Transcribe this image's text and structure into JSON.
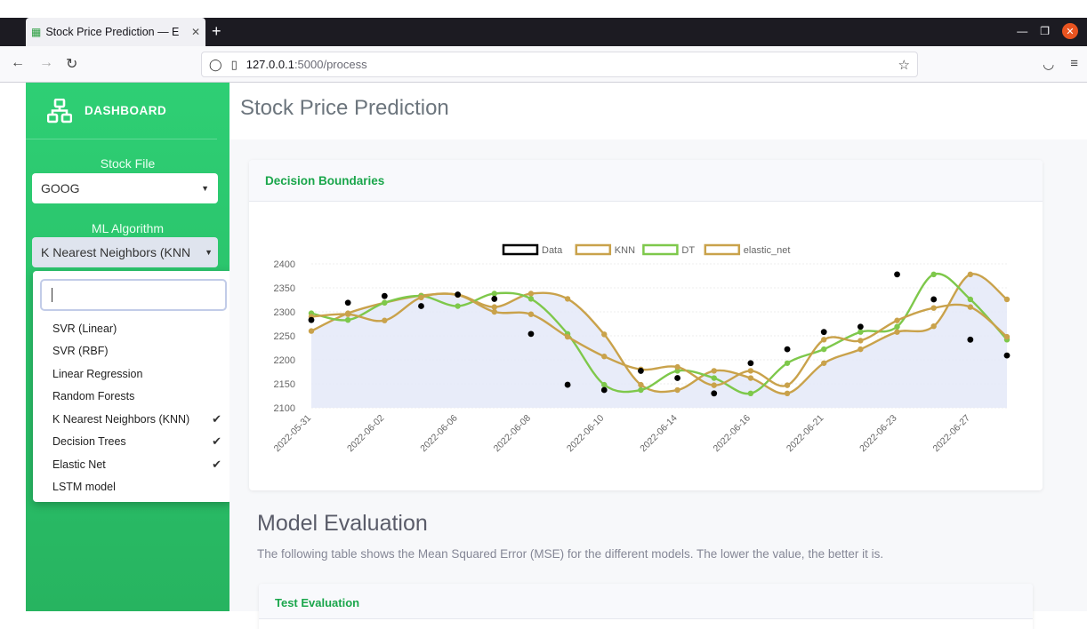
{
  "browser": {
    "tab_title": "Stock Price Prediction — E",
    "tab_close": "✕",
    "new_tab": "+",
    "url_host": "127.0.0.1",
    "url_path": ":5000/process"
  },
  "sidebar": {
    "brand": "DASHBOARD",
    "stock_file_label": "Stock File",
    "stock_file_value": "GOOG",
    "ml_algorithm_label": "ML Algorithm",
    "ml_algorithm_value": "K Nearest Neighbors (KNN",
    "dropdown": {
      "search_value": "",
      "options": [
        {
          "label": "SVR (Linear)",
          "selected": false
        },
        {
          "label": "SVR (RBF)",
          "selected": false
        },
        {
          "label": "Linear Regression",
          "selected": false
        },
        {
          "label": "Random Forests",
          "selected": false
        },
        {
          "label": "K Nearest Neighbors (KNN)",
          "selected": true
        },
        {
          "label": "Decision Trees",
          "selected": true
        },
        {
          "label": "Elastic Net",
          "selected": true
        },
        {
          "label": "LSTM model",
          "selected": false
        }
      ]
    }
  },
  "main": {
    "page_title": "Stock Price Prediction",
    "chart_card_title": "Decision Boundaries",
    "section_title": "Model Evaluation",
    "section_desc": "The following table shows the Mean Squared Error (MSE) for the different models. The lower the value, the better it is.",
    "test_card_title": "Test Evaluation"
  },
  "colors": {
    "sidebar_green": "#2ecf74",
    "accent_green": "#1aa64b",
    "knn": "#c9a24b",
    "dt": "#7ec84b",
    "elastic_net": "#c9a24b",
    "data": "#000000",
    "area_fill": "#e4e9f8"
  },
  "chart_data": {
    "type": "line",
    "title": "",
    "xlabel": "",
    "ylabel": "",
    "ylim": [
      2100,
      2400
    ],
    "yticks": [
      2100,
      2150,
      2200,
      2250,
      2300,
      2350,
      2400
    ],
    "x": [
      "2022-05-31",
      "2022-06-01",
      "2022-06-02",
      "2022-06-03",
      "2022-06-06",
      "2022-06-07",
      "2022-06-08",
      "2022-06-09",
      "2022-06-10",
      "2022-06-13",
      "2022-06-14",
      "2022-06-15",
      "2022-06-16",
      "2022-06-17",
      "2022-06-21",
      "2022-06-22",
      "2022-06-23",
      "2022-06-24",
      "2022-06-27",
      "2022-06-28"
    ],
    "xtick_labels": [
      "2022-05-31",
      "2022-06-02",
      "2022-06-06",
      "2022-06-08",
      "2022-06-10",
      "2022-06-14",
      "2022-06-16",
      "2022-06-21",
      "2022-06-23",
      "2022-06-27"
    ],
    "legend_position": "top",
    "series": [
      {
        "name": "Data",
        "kind": "scatter",
        "color": "#000000",
        "values": [
          2283,
          2319,
          2333,
          2312,
          2336,
          2327,
          2254,
          2148,
          2137,
          2177,
          2162,
          2130,
          2193,
          2222,
          2258,
          2269,
          2378,
          2326,
          2242,
          2209
        ]
      },
      {
        "name": "KNN",
        "kind": "line",
        "color": "#c9a24b",
        "values": [
          2260,
          2297,
          2319,
          2334,
          2336,
          2310,
          2338,
          2327,
          2253,
          2148,
          2137,
          2177,
          2162,
          2130,
          2193,
          2222,
          2258,
          2270,
          2378,
          2326
        ]
      },
      {
        "name": "DT",
        "kind": "line",
        "color": "#7ec84b",
        "values": [
          2297,
          2283,
          2319,
          2333,
          2312,
          2338,
          2327,
          2254,
          2148,
          2137,
          2177,
          2162,
          2130,
          2193,
          2222,
          2258,
          2269,
          2378,
          2326,
          2242
        ]
      },
      {
        "name": "elastic_net",
        "kind": "line",
        "color": "#c9a24b",
        "values": [
          2290,
          2295,
          2282,
          2330,
          2335,
          2300,
          2295,
          2248,
          2207,
          2180,
          2185,
          2147,
          2177,
          2147,
          2242,
          2240,
          2282,
          2308,
          2310,
          2248
        ]
      }
    ],
    "area_fill": true
  }
}
